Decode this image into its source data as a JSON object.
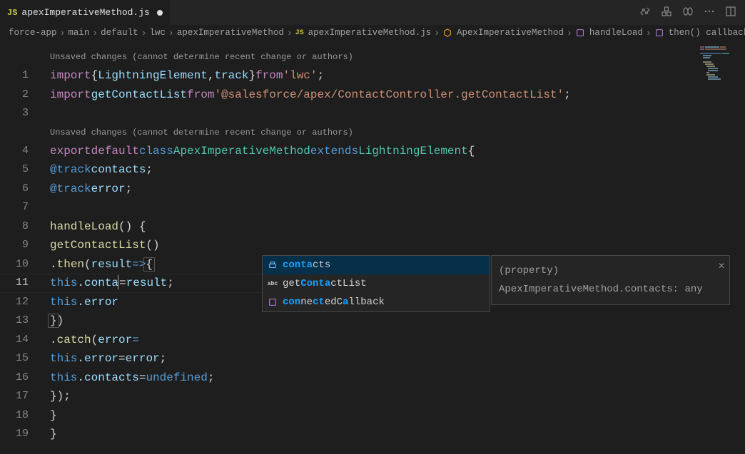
{
  "tab": {
    "icon": "JS",
    "filename": "apexImperativeMethod.js",
    "dirty": true
  },
  "breadcrumb": {
    "items": [
      {
        "label": "force-app"
      },
      {
        "label": "main"
      },
      {
        "label": "default"
      },
      {
        "label": "lwc"
      },
      {
        "label": "apexImperativeMethod"
      },
      {
        "label": "apexImperativeMethod.js",
        "icon": "js"
      },
      {
        "label": "ApexImperativeMethod",
        "icon": "class"
      },
      {
        "label": "handleLoad",
        "icon": "method"
      },
      {
        "label": "then() callback",
        "icon": "method"
      }
    ]
  },
  "codelens": "Unsaved changes (cannot determine recent change or authors)",
  "gutter": {
    "start": 1,
    "end": 19
  },
  "code": {
    "import_kw": "import",
    "from_kw": "from",
    "export_kw": "export",
    "default_kw": "default",
    "class_kw": "class",
    "extends_kw": "extends",
    "lightning_el": "LightningElement",
    "track": "track",
    "lwc_str": "'lwc'",
    "getContactList": "getContactList",
    "apex_str": "'@salesforce/apex/ContactController.getContactList'",
    "class_name": "ApexImperativeMethod",
    "at_track": "@track",
    "contacts": "contacts",
    "error": "error",
    "handleLoad": "handleLoad",
    "then": "then",
    "result": "result",
    "this": "this",
    "conta_partial": "conta",
    "catch": "catch",
    "undefined": "undefined"
  },
  "suggest": {
    "items": [
      {
        "kind": "field",
        "pre": "",
        "hl": "conta",
        "post": "cts"
      },
      {
        "kind": "abc",
        "pre": "get",
        "hl": "Conta",
        "post": "ctList"
      },
      {
        "kind": "method",
        "pre": "",
        "hl": "con",
        "mid1": "ne",
        "hl2": "ct",
        "mid2": "edC",
        "hl3": "a",
        "post": "llback"
      }
    ]
  },
  "detail": {
    "text": "(property) ApexImperativeMethod.contacts: any"
  }
}
